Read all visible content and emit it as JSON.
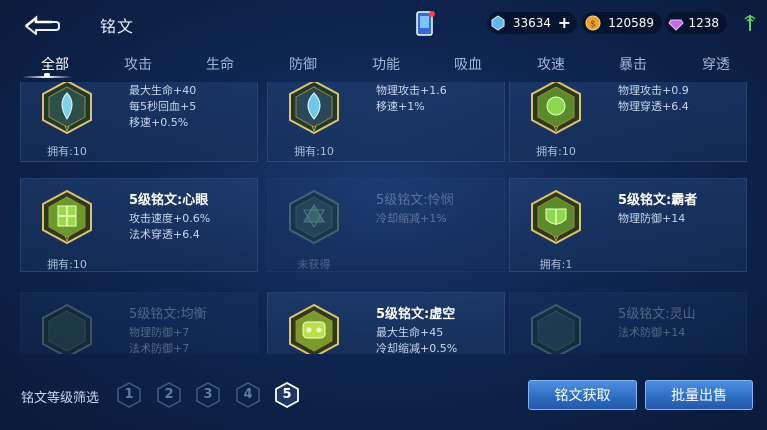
{
  "header": {
    "title": "铭文",
    "diamonds": "33634",
    "gold": "120589",
    "gems": "1238"
  },
  "tabs": [
    {
      "label": "全部",
      "active": true
    },
    {
      "label": "攻击"
    },
    {
      "label": "生命"
    },
    {
      "label": "防御"
    },
    {
      "label": "功能"
    },
    {
      "label": "吸血"
    },
    {
      "label": "攻速"
    },
    {
      "label": "暴击"
    },
    {
      "label": "穿透"
    }
  ],
  "cards": [
    {
      "name": "",
      "stats": [
        "最大生命+40",
        "每5秒回血+5",
        "移速+0.5%"
      ],
      "owned": "拥有:10",
      "color": "#7fd0e8",
      "dim": false
    },
    {
      "name": "",
      "stats": [
        "物理攻击+1.6",
        "移速+1%"
      ],
      "owned": "拥有:10",
      "color": "#6fc8e8",
      "dim": false
    },
    {
      "name": "",
      "stats": [
        "物理攻击+0.9",
        "物理穿透+6.4"
      ],
      "owned": "拥有:10",
      "color": "#8ed850",
      "dim": false
    },
    {
      "name": "5级铭文:心眼",
      "stats": [
        "攻击速度+0.6%",
        "法术穿透+6.4"
      ],
      "owned": "拥有:10",
      "color": "#9ad84a",
      "dim": false
    },
    {
      "name": "5级铭文:怜悯",
      "stats": [
        "冷却缩减+1%"
      ],
      "owned": "未获得",
      "color": "#6fb87a",
      "dim": true
    },
    {
      "name": "5级铭文:霸者",
      "stats": [
        "物理防御+14"
      ],
      "owned": "拥有:1",
      "color": "#8ed850",
      "dim": false
    },
    {
      "name": "5级铭文:均衡",
      "stats": [
        "物理防御+7",
        "法术防御+7"
      ],
      "owned": "",
      "color": "#6fb87a",
      "dim": true
    },
    {
      "name": "5级铭文:虚空",
      "stats": [
        "最大生命+45",
        "冷却缩减+0.5%"
      ],
      "owned": "",
      "color": "#b8e04a",
      "dim": false
    },
    {
      "name": "5级铭文:灵山",
      "stats": [
        "法术防御+14"
      ],
      "owned": "",
      "color": "#7fc8b0",
      "dim": true
    }
  ],
  "filter": {
    "label": "铭文等级筛选",
    "levels": [
      "1",
      "2",
      "3",
      "4",
      "5"
    ],
    "selected": "5"
  },
  "buttons": {
    "get": "铭文获取",
    "sell": "批量出售"
  }
}
